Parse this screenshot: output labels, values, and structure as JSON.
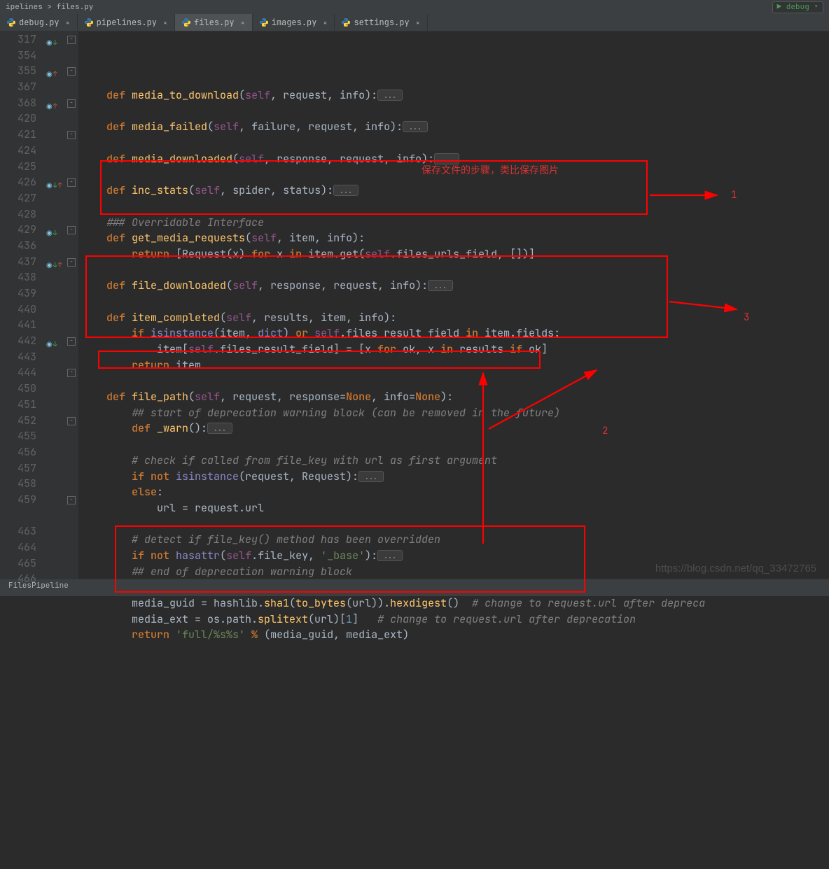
{
  "top_bar": {
    "left_crumb": "ipelines  >  files.py",
    "debug": "debug"
  },
  "tabs": [
    {
      "label": "debug.py",
      "active": false
    },
    {
      "label": "pipelines.py",
      "active": false
    },
    {
      "label": "files.py",
      "active": true
    },
    {
      "label": "images.py",
      "active": false
    },
    {
      "label": "settings.py",
      "active": false
    }
  ],
  "annotations": {
    "title": "保存文件的步骤，类比保存图片",
    "label_1": "1",
    "label_2": "2",
    "label_3": "3"
  },
  "watermark": "https://blog.csdn.net/qq_33472765",
  "status": "FilesPipeline",
  "gutter_lines": [
    "317",
    "354",
    "355",
    "367",
    "368",
    "420",
    "421",
    "424",
    "425",
    "426",
    "427",
    "428",
    "429",
    "436",
    "437",
    "438",
    "439",
    "440",
    "441",
    "442",
    "443",
    "444",
    "450",
    "451",
    "452",
    "455",
    "456",
    "457",
    "458",
    "459",
    "",
    "463",
    "464",
    "465",
    "466",
    ""
  ],
  "code_lines": [
    {
      "indent": 1,
      "tokens": [
        [
          "kw",
          "def "
        ],
        [
          "def",
          "media_to_download"
        ],
        [
          "",
          "("
        ],
        [
          "self",
          "self"
        ],
        [
          "",
          ", request, info):"
        ],
        [
          "fold",
          "..."
        ]
      ]
    },
    {
      "indent": 0,
      "tokens": [
        [
          "",
          ""
        ]
      ]
    },
    {
      "indent": 1,
      "tokens": [
        [
          "kw",
          "def "
        ],
        [
          "def",
          "media_failed"
        ],
        [
          "",
          "("
        ],
        [
          "self",
          "self"
        ],
        [
          "",
          ", failure, request, info):"
        ],
        [
          "fold",
          "..."
        ]
      ]
    },
    {
      "indent": 0,
      "tokens": [
        [
          "",
          ""
        ]
      ]
    },
    {
      "indent": 1,
      "tokens": [
        [
          "kw",
          "def "
        ],
        [
          "def",
          "media_downloaded"
        ],
        [
          "",
          "("
        ],
        [
          "self",
          "self"
        ],
        [
          "",
          ", response, request, info):"
        ],
        [
          "fold",
          "..."
        ]
      ]
    },
    {
      "indent": 0,
      "tokens": [
        [
          "",
          ""
        ]
      ]
    },
    {
      "indent": 1,
      "tokens": [
        [
          "kw",
          "def "
        ],
        [
          "def",
          "inc_stats"
        ],
        [
          "",
          "("
        ],
        [
          "self",
          "self"
        ],
        [
          "",
          ", spider, status):"
        ],
        [
          "fold",
          "..."
        ]
      ]
    },
    {
      "indent": 0,
      "tokens": [
        [
          "",
          ""
        ]
      ]
    },
    {
      "indent": 1,
      "tokens": [
        [
          "comment",
          "### Overridable Interface"
        ]
      ]
    },
    {
      "indent": 1,
      "tokens": [
        [
          "kw",
          "def "
        ],
        [
          "def",
          "get_media_requests"
        ],
        [
          "",
          "("
        ],
        [
          "self",
          "self"
        ],
        [
          "",
          ", item, info):"
        ]
      ]
    },
    {
      "indent": 2,
      "tokens": [
        [
          "kw",
          "return "
        ],
        [
          "",
          "["
        ],
        [
          "cls",
          "Request"
        ],
        [
          "",
          "(x) "
        ],
        [
          "kw",
          "for "
        ],
        [
          "",
          "x "
        ],
        [
          "kw",
          "in "
        ],
        [
          "",
          "item.get("
        ],
        [
          "self",
          "self"
        ],
        [
          "",
          ".files_urls_field, [])]"
        ]
      ]
    },
    {
      "indent": 0,
      "tokens": [
        [
          "",
          ""
        ]
      ]
    },
    {
      "indent": 1,
      "tokens": [
        [
          "kw",
          "def "
        ],
        [
          "def",
          "file_downloaded"
        ],
        [
          "",
          "("
        ],
        [
          "self",
          "self"
        ],
        [
          "",
          ", response, request, info):"
        ],
        [
          "fold",
          "..."
        ]
      ]
    },
    {
      "indent": 0,
      "tokens": [
        [
          "",
          ""
        ]
      ]
    },
    {
      "indent": 1,
      "tokens": [
        [
          "kw",
          "def "
        ],
        [
          "def",
          "item_completed"
        ],
        [
          "",
          "("
        ],
        [
          "self",
          "self"
        ],
        [
          "",
          ", results, item, info):"
        ]
      ]
    },
    {
      "indent": 2,
      "tokens": [
        [
          "kw",
          "if "
        ],
        [
          "builtin",
          "isinstance"
        ],
        [
          "",
          "(item, "
        ],
        [
          "builtin",
          "dict"
        ],
        [
          "",
          ") "
        ],
        [
          "kw",
          "or "
        ],
        [
          "self",
          "self"
        ],
        [
          "",
          ".files_result_field "
        ],
        [
          "kw",
          "in "
        ],
        [
          "",
          "item.fields:"
        ]
      ]
    },
    {
      "indent": 3,
      "tokens": [
        [
          "",
          "item["
        ],
        [
          "self",
          "self"
        ],
        [
          "",
          ".files_result_field] = [x "
        ],
        [
          "kw",
          "for "
        ],
        [
          "",
          "ok, x "
        ],
        [
          "kw",
          "in "
        ],
        [
          "",
          "results "
        ],
        [
          "kw",
          "if "
        ],
        [
          "",
          "ok]"
        ]
      ]
    },
    {
      "indent": 2,
      "tokens": [
        [
          "kw",
          "return "
        ],
        [
          "",
          "item"
        ]
      ]
    },
    {
      "indent": 0,
      "tokens": [
        [
          "",
          ""
        ]
      ]
    },
    {
      "indent": 1,
      "tokens": [
        [
          "kw",
          "def "
        ],
        [
          "def",
          "file_path"
        ],
        [
          "",
          "("
        ],
        [
          "self",
          "self"
        ],
        [
          "",
          ", request, response="
        ],
        [
          "kw",
          "None"
        ],
        [
          "",
          ", info="
        ],
        [
          "kw",
          "None"
        ],
        [
          "",
          "):"
        ]
      ]
    },
    {
      "indent": 2,
      "tokens": [
        [
          "comment",
          "## start of deprecation warning block (can be removed in the future)"
        ]
      ]
    },
    {
      "indent": 2,
      "tokens": [
        [
          "kw",
          "def "
        ],
        [
          "def",
          "_warn"
        ],
        [
          "",
          "():"
        ],
        [
          "fold",
          "..."
        ]
      ]
    },
    {
      "indent": 0,
      "tokens": [
        [
          "",
          ""
        ]
      ]
    },
    {
      "indent": 2,
      "tokens": [
        [
          "comment",
          "# check if called from file_key with url as first argument"
        ]
      ]
    },
    {
      "indent": 2,
      "tokens": [
        [
          "kw",
          "if not "
        ],
        [
          "builtin",
          "isinstance"
        ],
        [
          "",
          "(request, Request):"
        ],
        [
          "fold",
          "..."
        ]
      ]
    },
    {
      "indent": 2,
      "tokens": [
        [
          "kw",
          "else"
        ],
        [
          "",
          ":"
        ]
      ]
    },
    {
      "indent": 3,
      "tokens": [
        [
          "",
          "url = request.url"
        ]
      ]
    },
    {
      "indent": 0,
      "tokens": [
        [
          "",
          ""
        ]
      ]
    },
    {
      "indent": 2,
      "tokens": [
        [
          "comment",
          "# detect if file_key() method has been overridden"
        ]
      ]
    },
    {
      "indent": 2,
      "tokens": [
        [
          "kw",
          "if not "
        ],
        [
          "builtin",
          "hasattr"
        ],
        [
          "",
          "("
        ],
        [
          "self",
          "self"
        ],
        [
          "",
          ".file_key, "
        ],
        [
          "str",
          "'_base'"
        ],
        [
          "",
          "):"
        ],
        [
          "fold",
          "..."
        ]
      ]
    },
    {
      "indent": 2,
      "tokens": [
        [
          "comment",
          "## end of deprecation warning block"
        ]
      ]
    },
    {
      "indent": 0,
      "tokens": [
        [
          "",
          ""
        ]
      ]
    },
    {
      "indent": 2,
      "tokens": [
        [
          "",
          "media_guid = hashlib."
        ],
        [
          "def",
          "sha1"
        ],
        [
          "",
          "("
        ],
        [
          "def",
          "to_bytes"
        ],
        [
          "",
          "(url))."
        ],
        [
          "def",
          "hexdigest"
        ],
        [
          "",
          "()  "
        ],
        [
          "comment",
          "# change to request.url after depreca"
        ]
      ]
    },
    {
      "indent": 2,
      "tokens": [
        [
          "",
          "media_ext = os.path."
        ],
        [
          "def",
          "splitext"
        ],
        [
          "",
          "(url)["
        ],
        [
          "num",
          "1"
        ],
        [
          "",
          "]   "
        ],
        [
          "comment",
          "# change to request.url after deprecation"
        ]
      ]
    },
    {
      "indent": 2,
      "tokens": [
        [
          "kw",
          "return "
        ],
        [
          "str",
          "'full/%s%s'"
        ],
        [
          "",
          ""
        ],
        [
          "kw",
          " % "
        ],
        [
          "",
          "(media_guid, media_ext)"
        ]
      ]
    },
    {
      "indent": 0,
      "tokens": [
        [
          "",
          ""
        ]
      ]
    }
  ],
  "markers": [
    {
      "row": 0,
      "icons": [
        "ov",
        "dn"
      ]
    },
    {
      "row": 2,
      "icons": [
        "ov",
        "up"
      ]
    },
    {
      "row": 4,
      "icons": [
        "ov",
        "up"
      ]
    },
    {
      "row": 9,
      "icons": [
        "ov",
        "dn",
        "up"
      ]
    },
    {
      "row": 12,
      "icons": [
        "ov",
        "dn"
      ]
    },
    {
      "row": 14,
      "icons": [
        "ov",
        "dn",
        "up"
      ]
    },
    {
      "row": 19,
      "icons": [
        "ov",
        "dn"
      ]
    }
  ],
  "fold_icons_rows": [
    0,
    2,
    4,
    6,
    9,
    12,
    14,
    19,
    21,
    24,
    29
  ]
}
